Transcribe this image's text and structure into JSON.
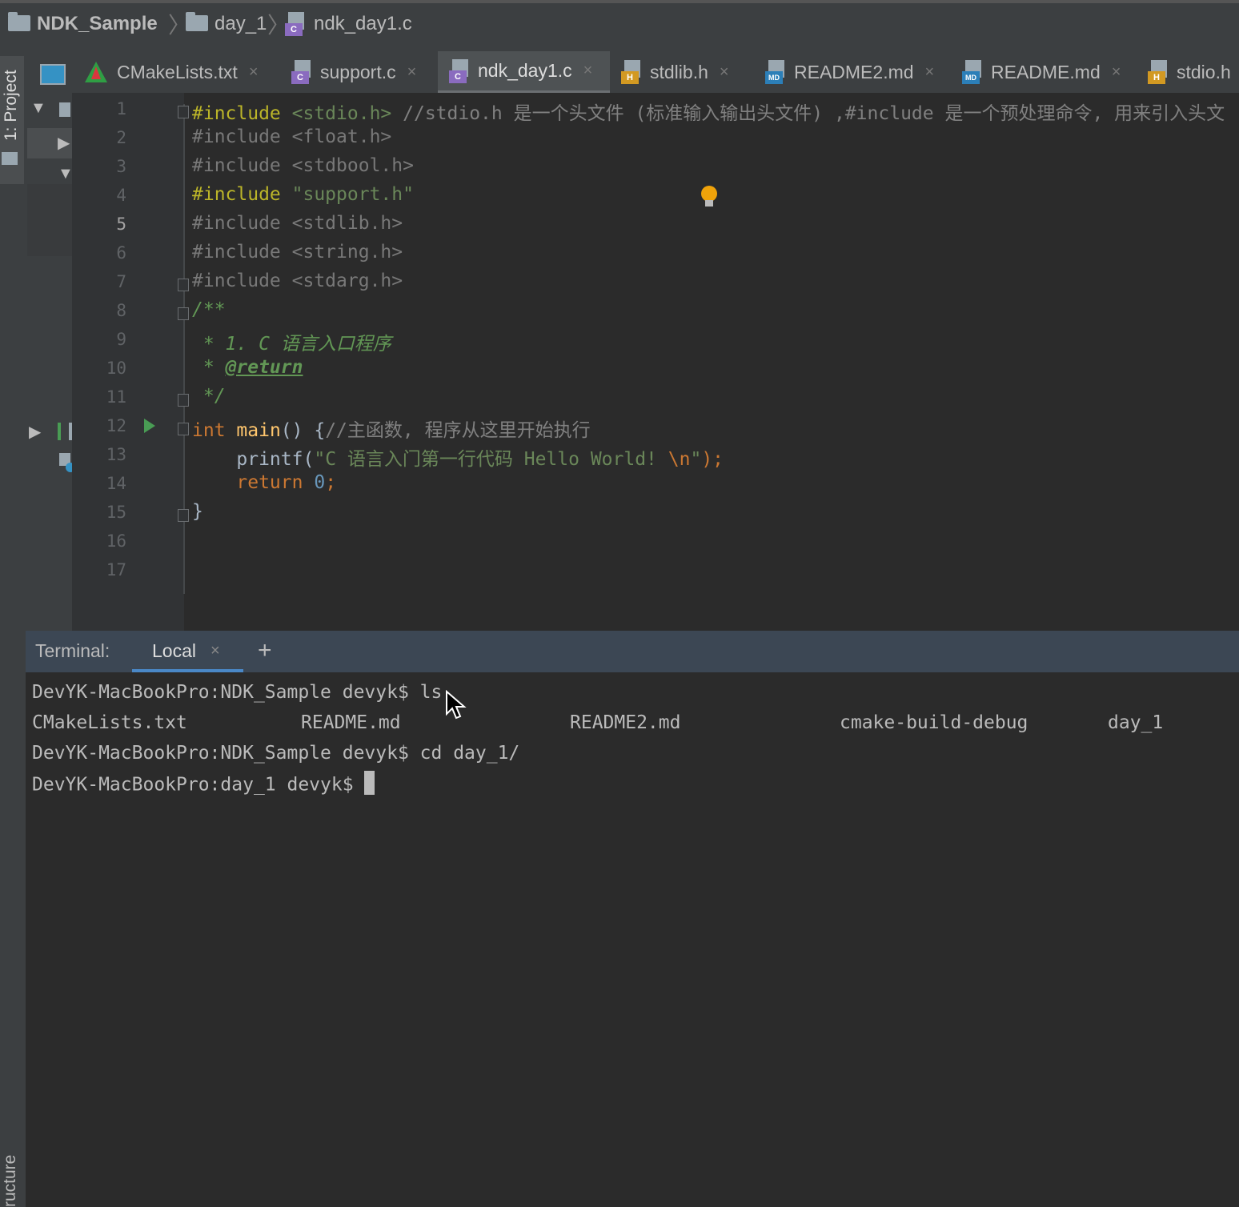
{
  "breadcrumb": {
    "project": "NDK_Sample",
    "folder": "day_1",
    "file": "ndk_day1.c"
  },
  "side_tabs": {
    "project": "1: Project",
    "structure": "ructure"
  },
  "tabs": [
    {
      "label": "CMakeLists.txt",
      "icon": "cmake-icon"
    },
    {
      "label": "support.c",
      "icon": "c-file-icon"
    },
    {
      "label": "ndk_day1.c",
      "icon": "c-file-icon",
      "active": true
    },
    {
      "label": "stdlib.h",
      "icon": "h-file-icon"
    },
    {
      "label": "README2.md",
      "icon": "md-file-icon"
    },
    {
      "label": "README.md",
      "icon": "md-file-icon"
    },
    {
      "label": "stdio.h",
      "icon": "h-file-icon"
    }
  ],
  "close_glyph": "×",
  "editor": {
    "current_line": 5,
    "line_numbers": [
      "1",
      "2",
      "3",
      "4",
      "5",
      "6",
      "7",
      "8",
      "9",
      "10",
      "11",
      "12",
      "13",
      "14",
      "15",
      "16",
      "17"
    ],
    "lines": {
      "l1": {
        "directive": "#include",
        "target": "<stdio.h>",
        "comment": "//stdio.h 是一个头文件 (标准输入输出头文件) ,#include 是一个预处理命令, 用来引入头文"
      },
      "l2": {
        "directive": "#include",
        "target": "<float.h>"
      },
      "l3": {
        "directive": "#include",
        "target": "<stdbool.h>"
      },
      "l4": {
        "directive": "#include",
        "target": "\"support.h\""
      },
      "l5": {
        "directive": "#include",
        "target": "<stdlib.h>"
      },
      "l6": {
        "directive": "#include",
        "target": "<string.h>"
      },
      "l7": {
        "directive": "#include",
        "target": "<stdarg.h>"
      },
      "l8": {
        "text": "/**"
      },
      "l9": {
        "text": " * 1. C 语言入口程序"
      },
      "l10": {
        "prefix": " * ",
        "tag": "@return"
      },
      "l11": {
        "text": " */"
      },
      "l12": {
        "type": "int",
        "name": "main",
        "rest": "() {",
        "comment": "//主函数, 程序从这里开始执行"
      },
      "l13": {
        "call": "printf",
        "open": "(",
        "string": "\"C 语言入门第一行代码 Hello World! ",
        "escape": "\\n",
        "string_end": "\"",
        "close": ");"
      },
      "l14": {
        "keyword": "return",
        "value": "0",
        "semi": ";"
      },
      "l15": {
        "text": "}"
      }
    }
  },
  "terminal": {
    "title": "Terminal:",
    "tab": "Local",
    "add": "+",
    "lines": [
      "DevYK-MacBookPro:NDK_Sample devyk$ ls",
      "DevYK-MacBookPro:NDK_Sample devyk$ cd day_1/",
      "DevYK-MacBookPro:day_1 devyk$ "
    ],
    "ls_output": [
      "CMakeLists.txt",
      "README.md",
      "README2.md",
      "cmake-build-debug",
      "day_1"
    ]
  },
  "colors": {
    "background": "#2b2b2b",
    "keyword": "#cc7832",
    "string": "#6a8759",
    "preprocessor": "#bbb529",
    "terminal_tab_underline": "#4a88c7",
    "run_gutter": "#499c54"
  }
}
